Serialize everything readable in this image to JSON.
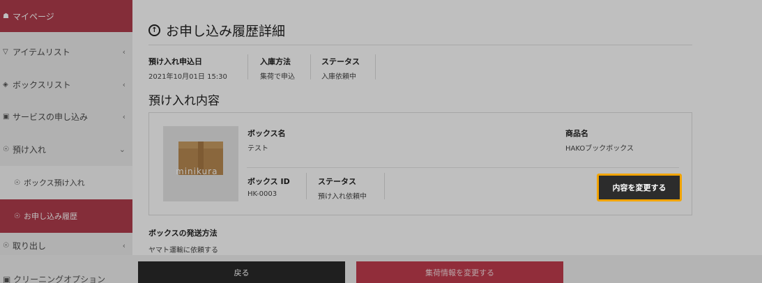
{
  "sidebar": {
    "items": [
      {
        "label": "マイページ",
        "icon": "home-icon"
      },
      {
        "label": "アイテムリスト",
        "icon": "tag-icon"
      },
      {
        "label": "ボックスリスト",
        "icon": "box-icon"
      },
      {
        "label": "サービスの申し込み",
        "icon": "cart-icon"
      },
      {
        "label": "預け入れ",
        "icon": "circle-arrow-icon"
      },
      {
        "label": "ボックス預け入れ",
        "icon": "circle-arrow-icon"
      },
      {
        "label": "お申し込み履歴",
        "icon": "circle-arrow-icon"
      },
      {
        "label": "取り出し",
        "icon": "circle-arrow-icon"
      },
      {
        "label": "クリーニングオプション",
        "icon": "cleaning-icon"
      }
    ]
  },
  "page": {
    "title": "お申し込み履歴詳細",
    "meta": {
      "date_label": "預け入れ申込日",
      "date_value": "2021年10月01日 15:30",
      "method_label": "入庫方法",
      "method_value": "集荷で申込",
      "status_label": "ステータス",
      "status_value": "入庫依頼中"
    },
    "section_title": "預け入れ内容",
    "card": {
      "box_name_label": "ボックス名",
      "box_name_value": "テスト",
      "product_label": "商品名",
      "product_value": "HAKOブックボックス",
      "box_id_label": "ボックス ID",
      "box_id_value": "HK-0003",
      "status_label": "ステータス",
      "status_value": "預け入れ依頼中",
      "change_button": "内容を変更する",
      "thumb_logo": "minikura"
    },
    "shipping": {
      "label": "ボックスの発送方法",
      "value": "ヤマト運輸に依頼する"
    }
  },
  "footer": {
    "back_button": "戻る",
    "pickup_button": "集荷情報を変更する"
  },
  "colors": {
    "accent": "#b03c4c",
    "highlight": "#f2a400",
    "dark_button": "#2c2c2c"
  }
}
